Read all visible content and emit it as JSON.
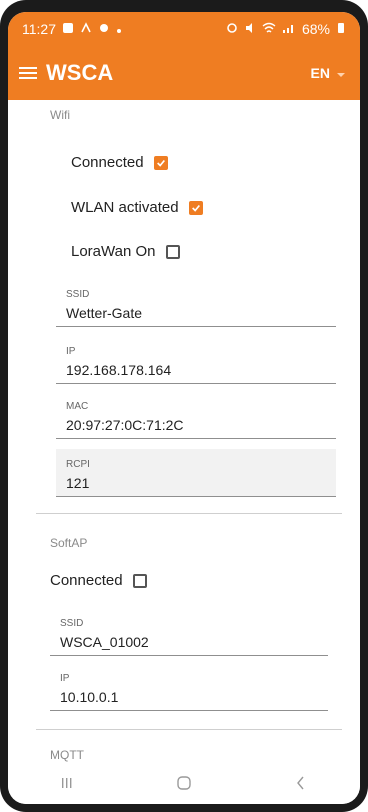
{
  "status": {
    "time": "11:27",
    "battery": "68%"
  },
  "app": {
    "title": "WSCA",
    "language": "EN"
  },
  "wifi": {
    "label": "Wifi",
    "connected_label": "Connected",
    "wlan_label": "WLAN activated",
    "lorawan_label": "LoraWan On",
    "ssid_label": "SSID",
    "ssid_value": "Wetter-Gate",
    "ip_label": "IP",
    "ip_value": "192.168.178.164",
    "mac_label": "MAC",
    "mac_value": "20:97:27:0C:71:2C",
    "rcpi_label": "RCPI",
    "rcpi_value": "121"
  },
  "softap": {
    "label": "SoftAP",
    "connected_label": "Connected",
    "ssid_label": "SSID",
    "ssid_value": "WSCA_01002",
    "ip_label": "IP",
    "ip_value": "10.10.0.1"
  },
  "mqtt": {
    "label": "MQTT"
  },
  "colors": {
    "accent": "#ef7d22"
  },
  "icons": {
    "menu": "menu-icon",
    "dropdown": "chevron-down-icon",
    "check": "checkmark-icon"
  }
}
